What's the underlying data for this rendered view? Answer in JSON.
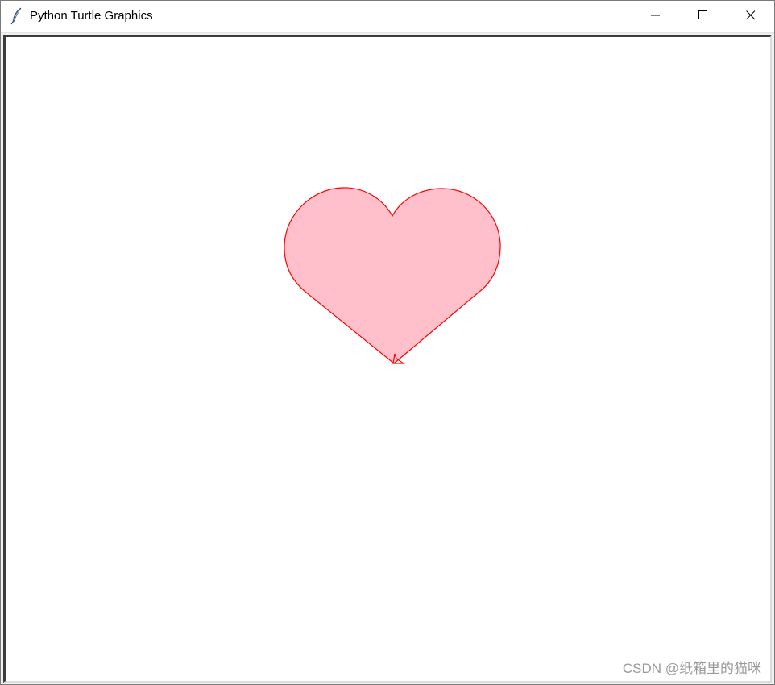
{
  "window": {
    "title": "Python Turtle Graphics",
    "icon": "feather-icon"
  },
  "controls": {
    "minimize_icon": "minimize-icon",
    "maximize_icon": "maximize-icon",
    "close_icon": "close-icon"
  },
  "canvas": {
    "background": "#ffffff",
    "shape": "heart",
    "fill_color": "#ffc0cb",
    "pen_color": "#ff0000",
    "cursor": "turtle-arrow-icon"
  },
  "watermark": {
    "text": "CSDN @纸箱里的猫咪"
  }
}
